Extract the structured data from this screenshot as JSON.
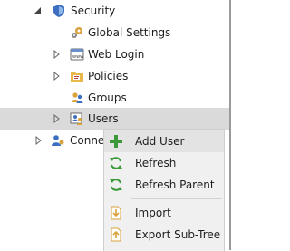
{
  "tree": {
    "security": "Security",
    "global_settings": "Global Settings",
    "web_login": "Web Login",
    "policies": "Policies",
    "groups": "Groups",
    "users": "Users",
    "connections": "Conne"
  },
  "context_menu": {
    "add_user": "Add User",
    "refresh": "Refresh",
    "refresh_parent": "Refresh Parent",
    "import": "Import",
    "export_sub_tree": "Export Sub-Tree"
  },
  "icons": {
    "security": "shield-icon",
    "global_settings": "gears-icon",
    "web_login": "web-icon",
    "policies": "policy-folder-icon",
    "groups": "groups-icon",
    "users": "users-icon",
    "connections": "connections-icon",
    "add_user": "plus-icon",
    "refresh": "refresh-icon",
    "refresh_parent": "refresh-parent-icon",
    "import": "import-icon",
    "export": "export-icon"
  },
  "colors": {
    "selection": "#dadada",
    "menu_bg": "#f0f0f0",
    "menu_hover": "#e3e3e3",
    "accent_green": "#3a9a3a",
    "accent_blue": "#2b6cc4"
  }
}
